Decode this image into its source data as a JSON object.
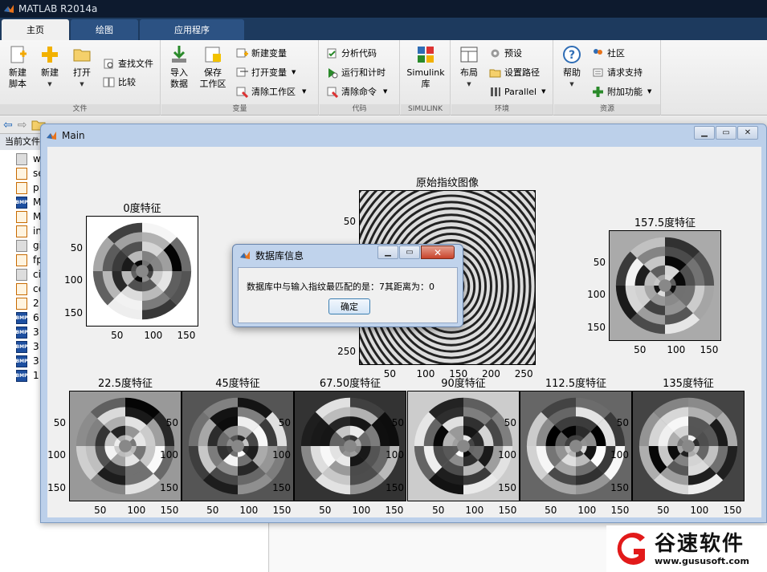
{
  "app": {
    "title": "MATLAB R2014a"
  },
  "tabs": [
    {
      "label": "主页"
    },
    {
      "label": "绘图"
    },
    {
      "label": "应用程序"
    }
  ],
  "ribbon": {
    "groups": {
      "file": "文件",
      "variable": "变量",
      "code": "代码",
      "simulink": "SIMULINK",
      "environment": "环境",
      "resources": "资源"
    },
    "new_script": "新建\n脚本",
    "new": "新建",
    "open": "打开",
    "find_files": "查找文件",
    "compare": "比较",
    "import_data": "导入\n数据",
    "save_workspace": "保存\n工作区",
    "new_variable": "新建变量",
    "open_variable": "打开变量",
    "clear_workspace": "清除工作区",
    "analyze_code": "分析代码",
    "run_and_time": "运行和计时",
    "clear_commands": "清除命令",
    "simulink_library": "Simulink\n库",
    "layout": "布局",
    "preferences": "预设",
    "set_path": "设置路径",
    "parallel": "Parallel",
    "help": "帮助",
    "community": "社区",
    "request_support": "请求支持",
    "addons": "附加功能"
  },
  "current_folder": {
    "title": "当前文件",
    "files": [
      "w",
      "se",
      "p",
      "M",
      "M",
      "in",
      "gi",
      "fp",
      "ci",
      "ce",
      "2",
      "6",
      "3",
      "3",
      "3",
      "1"
    ]
  },
  "figure": {
    "title": "Main"
  },
  "plots": {
    "original": {
      "title": "原始指纹图像",
      "yticks": [
        "50",
        "100",
        "150",
        "200",
        "250"
      ],
      "xticks": [
        "50",
        "100",
        "150",
        "200",
        "250"
      ]
    },
    "f0": {
      "title": "0度特征"
    },
    "f157": {
      "title": "157.5度特征"
    },
    "f22": {
      "title": "22.5度特征"
    },
    "f45": {
      "title": "45度特征"
    },
    "f67": {
      "title": "67.50度特征"
    },
    "f90": {
      "title": "90度特征"
    },
    "f112": {
      "title": "112.5度特征"
    },
    "f135": {
      "title": "135度特征"
    },
    "ticks": [
      "50",
      "100",
      "150"
    ]
  },
  "dialog": {
    "title": "数据库信息",
    "message": "数据库中与输入指纹最匹配的是：7其距离为：0",
    "ok": "确定"
  },
  "watermark": {
    "name": "谷速软件",
    "url": "www.gususoft.com",
    "accent": "#e21a1a"
  }
}
